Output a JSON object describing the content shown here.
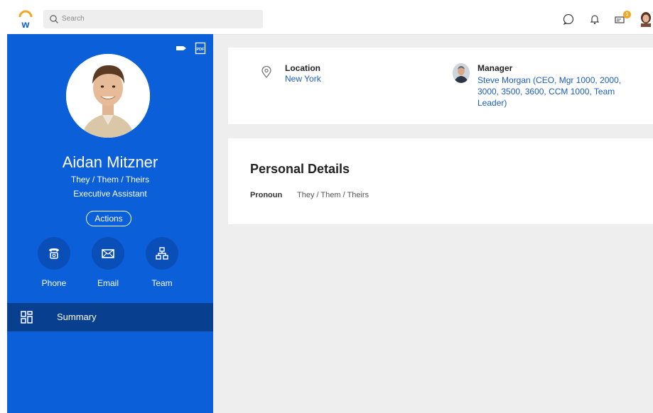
{
  "topbar": {
    "search_placeholder": "Search",
    "notification_count": "1",
    "icons": [
      "workday-logo-icon",
      "search-icon",
      "chat-icon",
      "bell-icon",
      "inbox-icon",
      "user-avatar"
    ]
  },
  "profile": {
    "name": "Aidan Mitzner",
    "pronouns": "They / Them / Theirs",
    "job_title": "Executive Assistant",
    "actions_label": "Actions",
    "contacts": [
      {
        "label": "Phone",
        "icon": "phone-icon"
      },
      {
        "label": "Email",
        "icon": "email-icon"
      },
      {
        "label": "Team",
        "icon": "team-icon"
      }
    ],
    "nav": {
      "summary_label": "Summary"
    },
    "tool_icons": [
      "tag-icon",
      "pdf-icon"
    ]
  },
  "overview": {
    "location_label": "Location",
    "location_value": "New York",
    "manager_label": "Manager",
    "manager_value": "Steve Morgan (CEO, Mgr 1000, 2000, 3000, 3500, 3600, CCM 1000, Team Leader)"
  },
  "personal_details": {
    "title": "Personal Details",
    "pronoun_label": "Pronoun",
    "pronoun_value": "They / Them / Theirs"
  },
  "colors": {
    "brand_blue": "#0b5fd8",
    "active_nav": "#083f8f",
    "link": "#1a5dc6",
    "badge": "#f6a623"
  }
}
